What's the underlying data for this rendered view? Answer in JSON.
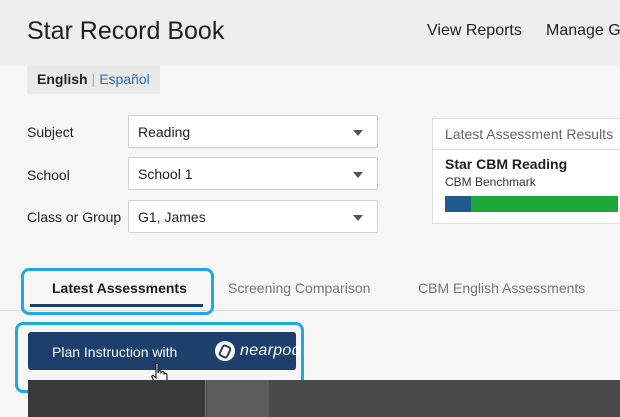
{
  "header": {
    "title": "Star Record Book",
    "nav": [
      "View Reports",
      "Manage Gr"
    ]
  },
  "language": {
    "english": "English",
    "separator": "|",
    "spanish": "Español"
  },
  "filters": [
    {
      "label": "Subject",
      "value": "Reading"
    },
    {
      "label": "School",
      "value": "School 1"
    },
    {
      "label": "Class or Group",
      "value": "G1, James"
    }
  ],
  "results_card": {
    "header": "Latest Assessment Results",
    "title": "Star CBM Reading",
    "subtitle": "CBM Benchmark",
    "bar_fractions": {
      "blue": 0.15,
      "green": 0.85
    },
    "colors": {
      "blue": "#1e5a8e",
      "green": "#1ea83c"
    }
  },
  "tabs": [
    {
      "label": "Latest Assessments",
      "active": true
    },
    {
      "label": "Screening Comparison",
      "active": false
    },
    {
      "label": "CBM English Assessments",
      "active": false
    }
  ],
  "plan_button": {
    "label": "Plan Instruction with",
    "brand": "nearpod"
  },
  "colors": {
    "accent": "#1c3f6b",
    "highlight": "#1ea9e0"
  }
}
